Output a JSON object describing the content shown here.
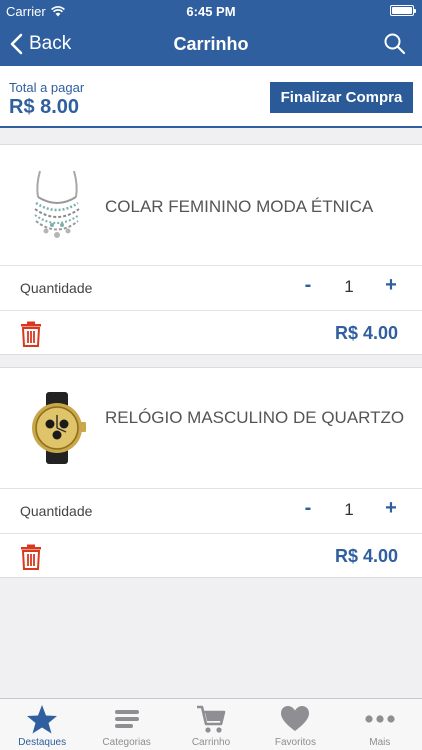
{
  "status_bar": {
    "carrier": "Carrier",
    "time": "6:45 PM"
  },
  "nav": {
    "back_label": "Back",
    "title": "Carrinho"
  },
  "summary": {
    "total_label": "Total a pagar",
    "total_value": "R$ 8.00",
    "checkout_label": "Finalizar Compra"
  },
  "items": [
    {
      "name": "COLAR FEMININO MODA ÉTNICA",
      "quantity_label": "Quantidade",
      "minus": "-",
      "quantity": "1",
      "plus": "+",
      "price": "R$ 4.00"
    },
    {
      "name": "RELÓGIO MASCULINO DE QUARTZO",
      "quantity_label": "Quantidade",
      "minus": "-",
      "quantity": "1",
      "plus": "+",
      "price": "R$ 4.00"
    }
  ],
  "tabs": [
    {
      "label": "Destaques",
      "icon": "star-icon",
      "active": true
    },
    {
      "label": "Categorias",
      "icon": "list-icon",
      "active": false
    },
    {
      "label": "Carrinho",
      "icon": "cart-icon",
      "active": false
    },
    {
      "label": "Favoritos",
      "icon": "heart-icon",
      "active": false
    },
    {
      "label": "Mais",
      "icon": "more-icon",
      "active": false
    }
  ],
  "colors": {
    "primary": "#2f5f9e",
    "delete": "#d9381e",
    "tab_inactive": "#8e8e93"
  }
}
